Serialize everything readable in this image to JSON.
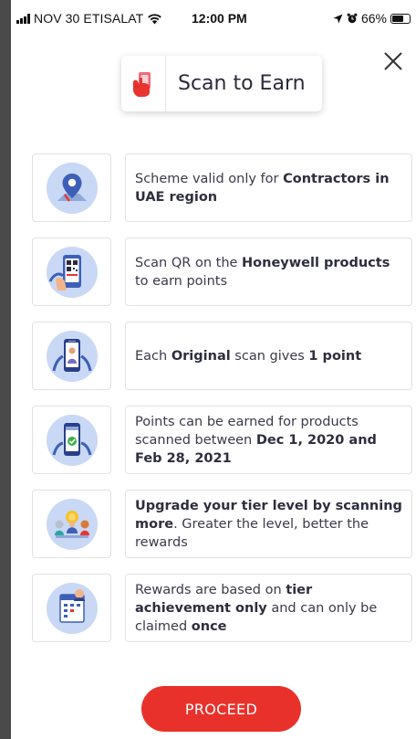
{
  "status_bar": {
    "carrier": "NOV 30 ETISALAT",
    "time": "12:00 PM",
    "battery": "66%",
    "battery_level": 0.66
  },
  "header": {
    "title": "Scan to Earn"
  },
  "rules": [
    {
      "icon": "location-pin-icon",
      "parts": [
        {
          "text": "Scheme valid only for ",
          "bold": false
        },
        {
          "text": "Contractors in UAE region",
          "bold": true
        }
      ]
    },
    {
      "icon": "scan-qr-icon",
      "parts": [
        {
          "text": "Scan QR on the ",
          "bold": false
        },
        {
          "text": "Honeywell products",
          "bold": true
        },
        {
          "text": " to earn points",
          "bold": false
        }
      ]
    },
    {
      "icon": "phone-scan-icon",
      "parts": [
        {
          "text": "Each ",
          "bold": false
        },
        {
          "text": "Original",
          "bold": true
        },
        {
          "text": " scan gives ",
          "bold": false
        },
        {
          "text": "1 point",
          "bold": true
        }
      ]
    },
    {
      "icon": "calendar-phone-icon",
      "parts": [
        {
          "text": "Points can be earned for products scanned between ",
          "bold": false
        },
        {
          "text": "Dec 1, 2020 and Feb 28, 2021",
          "bold": true
        }
      ]
    },
    {
      "icon": "tier-medals-icon",
      "parts": [
        {
          "text": "Upgrade your tier level by scanning more",
          "bold": true
        },
        {
          "text": ". Greater the level, better the rewards",
          "bold": false
        }
      ]
    },
    {
      "icon": "rewards-calendar-icon",
      "parts": [
        {
          "text": "Rewards are based on ",
          "bold": false
        },
        {
          "text": "tier achievement only",
          "bold": true
        },
        {
          "text": " and can only be claimed ",
          "bold": false
        },
        {
          "text": "once",
          "bold": true
        }
      ]
    }
  ],
  "proceed_label": "PROCEED",
  "colors": {
    "accent": "#e9312b",
    "icon_circle": "#c9d8f4",
    "icon_blue": "#3d5fb8"
  }
}
